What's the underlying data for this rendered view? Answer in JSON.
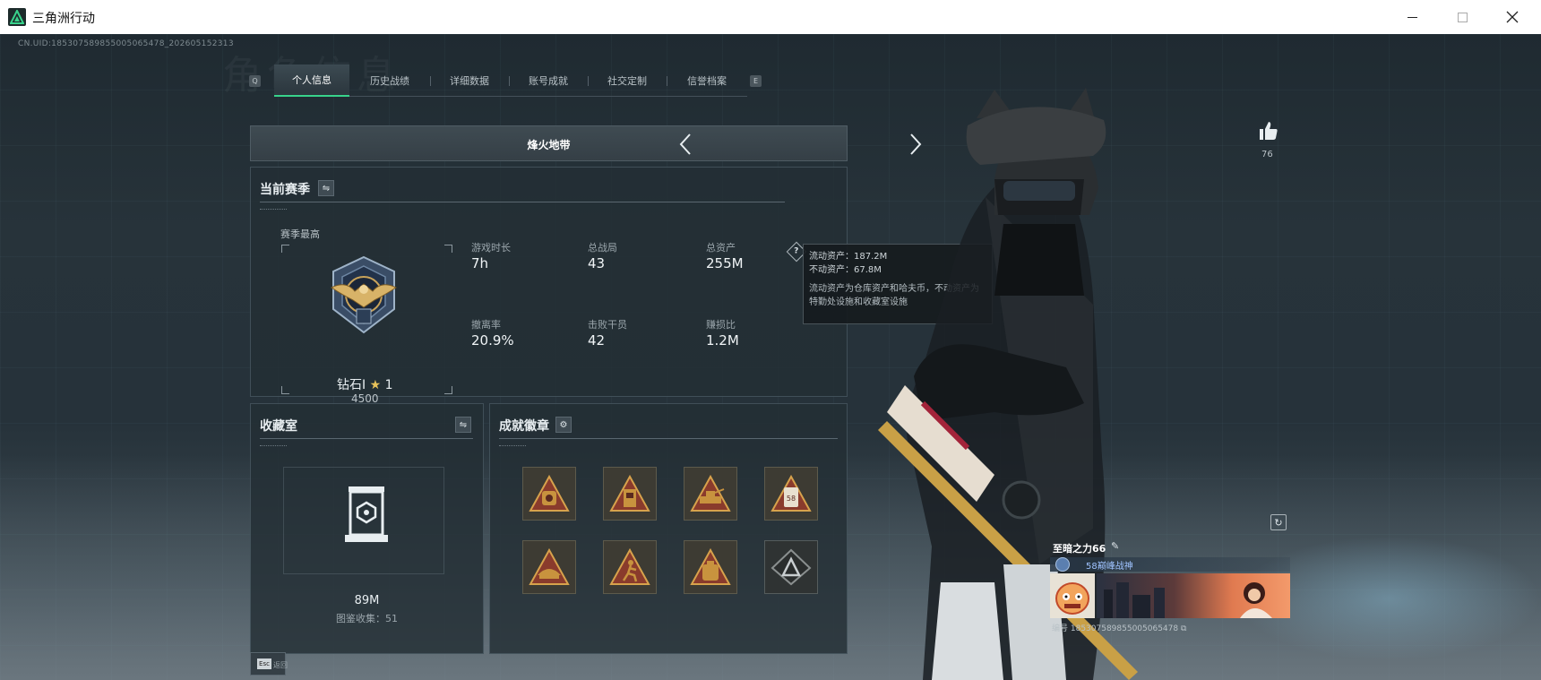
{
  "window": {
    "title": "三角洲行动",
    "minimize_label": "—",
    "maximize_label": "☐",
    "close_label": "✕"
  },
  "uid_text": "CN.UID:185307589855005065478_202605152313",
  "watermark": "角色信息",
  "tabs": {
    "left_key": "Q",
    "right_key": "E",
    "items": [
      {
        "label": "个人信息",
        "active": true
      },
      {
        "label": "历史战绩",
        "active": false
      },
      {
        "label": "详细数据",
        "active": false
      },
      {
        "label": "账号成就",
        "active": false
      },
      {
        "label": "社交定制",
        "active": false
      },
      {
        "label": "信誉档案",
        "active": false
      }
    ]
  },
  "mode": {
    "title": "烽火地带",
    "prev_icon": "chevron-left-icon",
    "next_icon": "chevron-right-icon"
  },
  "season": {
    "title": "当前赛季",
    "switch_icon": "swap-icon",
    "best_label": "赛季最高",
    "rank_name": "钻石I",
    "rank_stars": "1",
    "rank_score": "4500",
    "stats": [
      {
        "label": "游戏时长",
        "value": "7h"
      },
      {
        "label": "总战局",
        "value": "43"
      },
      {
        "label": "总资产",
        "value": "255M"
      },
      {
        "label": "撤离率",
        "value": "20.9%"
      },
      {
        "label": "击败干员",
        "value": "42"
      },
      {
        "label": "赚损比",
        "value": "1.2M"
      }
    ],
    "help_glyph": "?"
  },
  "tooltip": {
    "line1": "流动资产：187.2M",
    "line2": "不动资产：67.8M",
    "note": "流动资产为仓库资产和哈夫币，不动资产为特勤处设施和收藏室设施"
  },
  "collection": {
    "title": "收藏室",
    "value": "89M",
    "count_text": "图鉴收集：51"
  },
  "badges": {
    "title": "成就徽章",
    "settings_icon": "gear-icon",
    "items": [
      {
        "icon": "badge-bag-icon"
      },
      {
        "icon": "badge-backpack-icon"
      },
      {
        "icon": "badge-vehicle-icon"
      },
      {
        "icon": "badge-card-icon",
        "text": "58"
      },
      {
        "icon": "badge-boat-icon"
      },
      {
        "icon": "badge-runner-icon"
      },
      {
        "icon": "badge-pack-icon"
      },
      {
        "icon": "badge-triangle-icon"
      }
    ]
  },
  "footer": {
    "esc_key": "Esc",
    "esc_label": "返回"
  },
  "social": {
    "like_count": "76"
  },
  "player_card": {
    "name": "至暗之力66",
    "title": "58巅峰战神",
    "id_text": "编号 185307589855005065478"
  },
  "colors": {
    "accent": "#38d38b",
    "panel_bg": "#232e35",
    "badge_gold": "#c8933e"
  }
}
